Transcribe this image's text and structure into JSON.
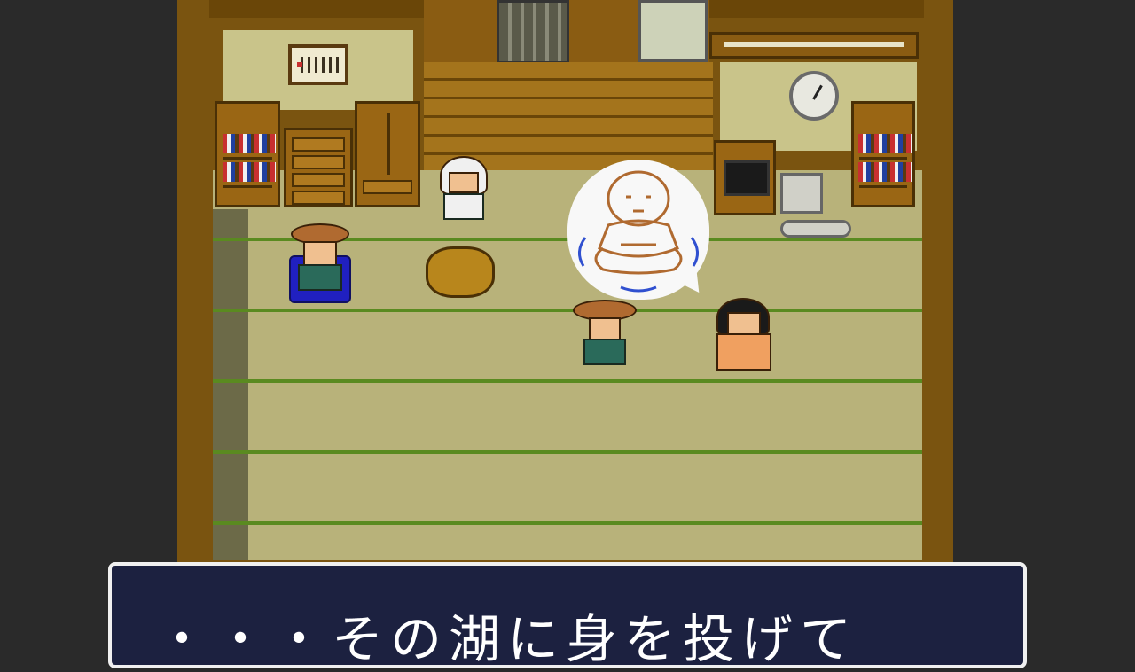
{
  "dialog": {
    "text": "・・・その湖に身を投げて"
  },
  "colors": {
    "background": "#2a2a2a",
    "wood": "#7a5410",
    "tatami": "#b8b27a",
    "tatami_line": "#5a8a20",
    "dialog_bg": "#1c2140",
    "dialog_border": "#f0f0f0"
  },
  "icons": {
    "thought_bubble": "thought-bubble-icon",
    "clock": "clock-icon"
  }
}
